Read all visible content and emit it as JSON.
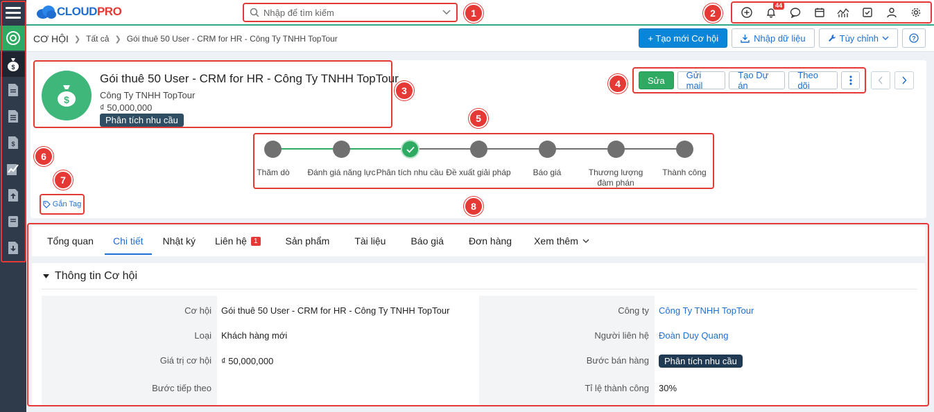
{
  "brand": {
    "part1": "CLOUD",
    "part2": "PRO"
  },
  "search": {
    "placeholder": "Nhập để tìm kiếm"
  },
  "notifications": {
    "badge": "44"
  },
  "callouts": [
    "1",
    "2",
    "3",
    "4",
    "5",
    "6",
    "7",
    "8"
  ],
  "breadcrumb": {
    "root": "CƠ HỘI",
    "all": "Tất cả",
    "current": "Gói thuê 50 User - CRM for HR - Công Ty TNHH TopTour"
  },
  "toolbar": {
    "create_label": "+ Tạo mới Cơ hội",
    "import_label": "Nhập dữ liệu",
    "customize_label": "Tùy chỉnh",
    "help_label": "?"
  },
  "record": {
    "title": "Gói thuê 50 User - CRM for HR - Công Ty TNHH TopTour",
    "company": "Công Ty TNHH TopTour",
    "value": "₫ 50,000,000",
    "stage": "Phân tích nhu cầu"
  },
  "actions": {
    "edit": "Sửa",
    "send_mail": "Gửi mail",
    "create_project": "Tạo Dự án",
    "follow": "Theo dõi"
  },
  "pipeline": {
    "stages": [
      {
        "label": "Thăm dò",
        "status": "done"
      },
      {
        "label": "Đánh giá năng lực",
        "status": "done"
      },
      {
        "label": "Phân tích nhu cầu",
        "status": "current"
      },
      {
        "label": "Đề xuất giải pháp",
        "status": "todo"
      },
      {
        "label": "Báo giá",
        "status": "todo"
      },
      {
        "label": "Thương lượng đàm phán",
        "status": "todo"
      },
      {
        "label": "Thành công",
        "status": "todo"
      }
    ]
  },
  "tag_button": "Gắn Tag",
  "tabs": [
    {
      "label": "Tổng quan"
    },
    {
      "label": "Chi tiết",
      "active": true
    },
    {
      "label": "Nhật ký"
    },
    {
      "label": "Liên hệ",
      "count": "1"
    },
    {
      "label": "Sản phẩm"
    },
    {
      "label": "Tài liệu"
    },
    {
      "label": "Báo giá"
    },
    {
      "label": "Đơn hàng"
    },
    {
      "label": "Xem thêm"
    }
  ],
  "details": {
    "section_title": "Thông tin Cơ hội",
    "left": [
      {
        "label": "Cơ hội",
        "value": "Gói thuê 50 User - CRM for HR - Công Ty TNHH TopTour"
      },
      {
        "label": "Loại",
        "value": "Khách hàng mới"
      },
      {
        "label": "Giá trị cơ hội",
        "value": "₫ 50,000,000"
      },
      {
        "label": "Bước tiếp theo",
        "value": ""
      }
    ],
    "right": [
      {
        "label": "Công ty",
        "value": "Công Ty TNHH TopTour"
      },
      {
        "label": "Người liên hệ",
        "value": "Đoàn Duy Quang"
      },
      {
        "label": "Bước bán hàng",
        "value": "Phân tích nhu cầu"
      },
      {
        "label": "Tỉ lệ thành công",
        "value": "30%"
      }
    ]
  },
  "colors": {
    "accent_green": "#2eaa62",
    "primary_blue": "#0a86d8",
    "rail": "#2f3a4a",
    "highlight_red": "#e53935"
  }
}
